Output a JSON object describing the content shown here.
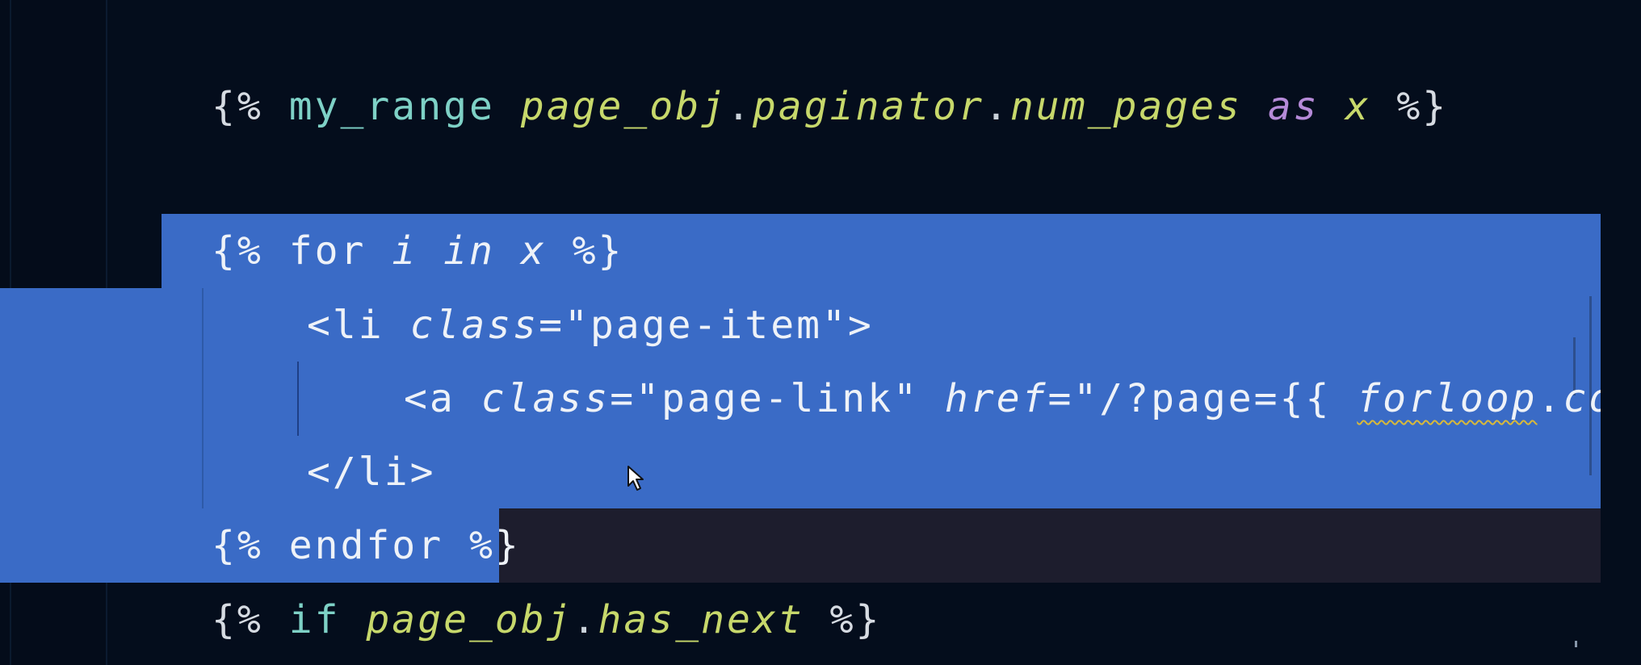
{
  "editor": {
    "lines": {
      "line1": {
        "open": "{%",
        "tag": "my_range",
        "var1": "page_obj",
        "dot1": ".",
        "var2": "paginator",
        "dot2": ".",
        "var3": "num_pages",
        "kw": "as",
        "name": "x",
        "close": "%}"
      },
      "line2": {
        "open": "{%",
        "kw_for": "for",
        "var_i": "i",
        "kw_in": "in",
        "var_x": "x",
        "close": "%}"
      },
      "line3": {
        "open_tag": "<li",
        "attr": "class",
        "eq_value": "=\"page-item\">"
      },
      "line4": {
        "open_tag": "<a",
        "attr1": "class",
        "value1": "=\"page-link\"",
        "attr2": "href",
        "value2": "=\"/?page={{",
        "var": "forloop",
        "dot": ".",
        "var2": "count"
      },
      "line5": {
        "close_tag": "</li>"
      },
      "line6": {
        "open": "{%",
        "kw": "endfor",
        "close": "%}"
      },
      "line7": {
        "open": "{%",
        "kw": "if",
        "var": "page_obj",
        "dot": ".",
        "var2": "has_next",
        "close": "%}"
      }
    }
  },
  "colors": {
    "background": "#040d1c",
    "selection": "#3a6bc6",
    "template_tag": "#7ed1c6",
    "variable": "#c7d86b",
    "keyword": "#b58ad8"
  },
  "icons": {
    "cursor": "mouse-pointer-icon"
  }
}
